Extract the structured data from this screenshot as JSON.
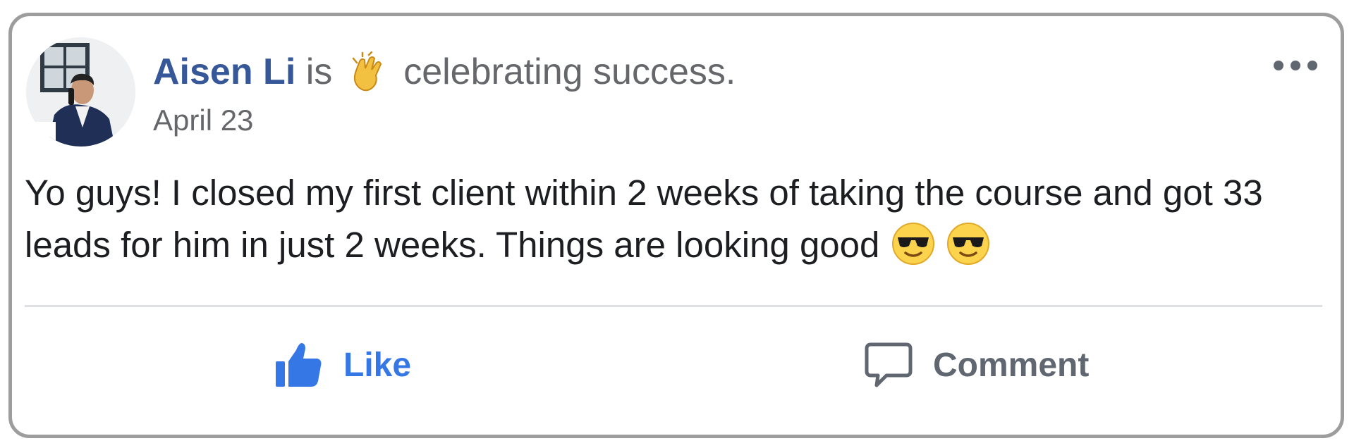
{
  "post": {
    "author_name": "Aisen Li",
    "verb": "is",
    "activity_emoji": "clapping-hands-emoji",
    "activity": "celebrating success.",
    "date": "April 23",
    "more_options_icon": "more-options-icon",
    "body_text": "Yo guys! I closed my first client within 2 weeks of taking the course and got 33 leads for him in just 2 weeks. Things are looking good",
    "body_emojis": [
      "smiling-face-with-sunglasses",
      "smiling-face-with-sunglasses"
    ]
  },
  "actions": {
    "like_label": "Like",
    "like_icon": "thumbs-up-icon",
    "comment_label": "Comment",
    "comment_icon": "speech-bubble-icon"
  },
  "colors": {
    "author_link": "#365899",
    "like_active": "#3578e5",
    "muted_text": "#65676b",
    "body_text": "#1c1e21",
    "divider": "#dddfe2",
    "frame_border": "#9d9d9d"
  }
}
